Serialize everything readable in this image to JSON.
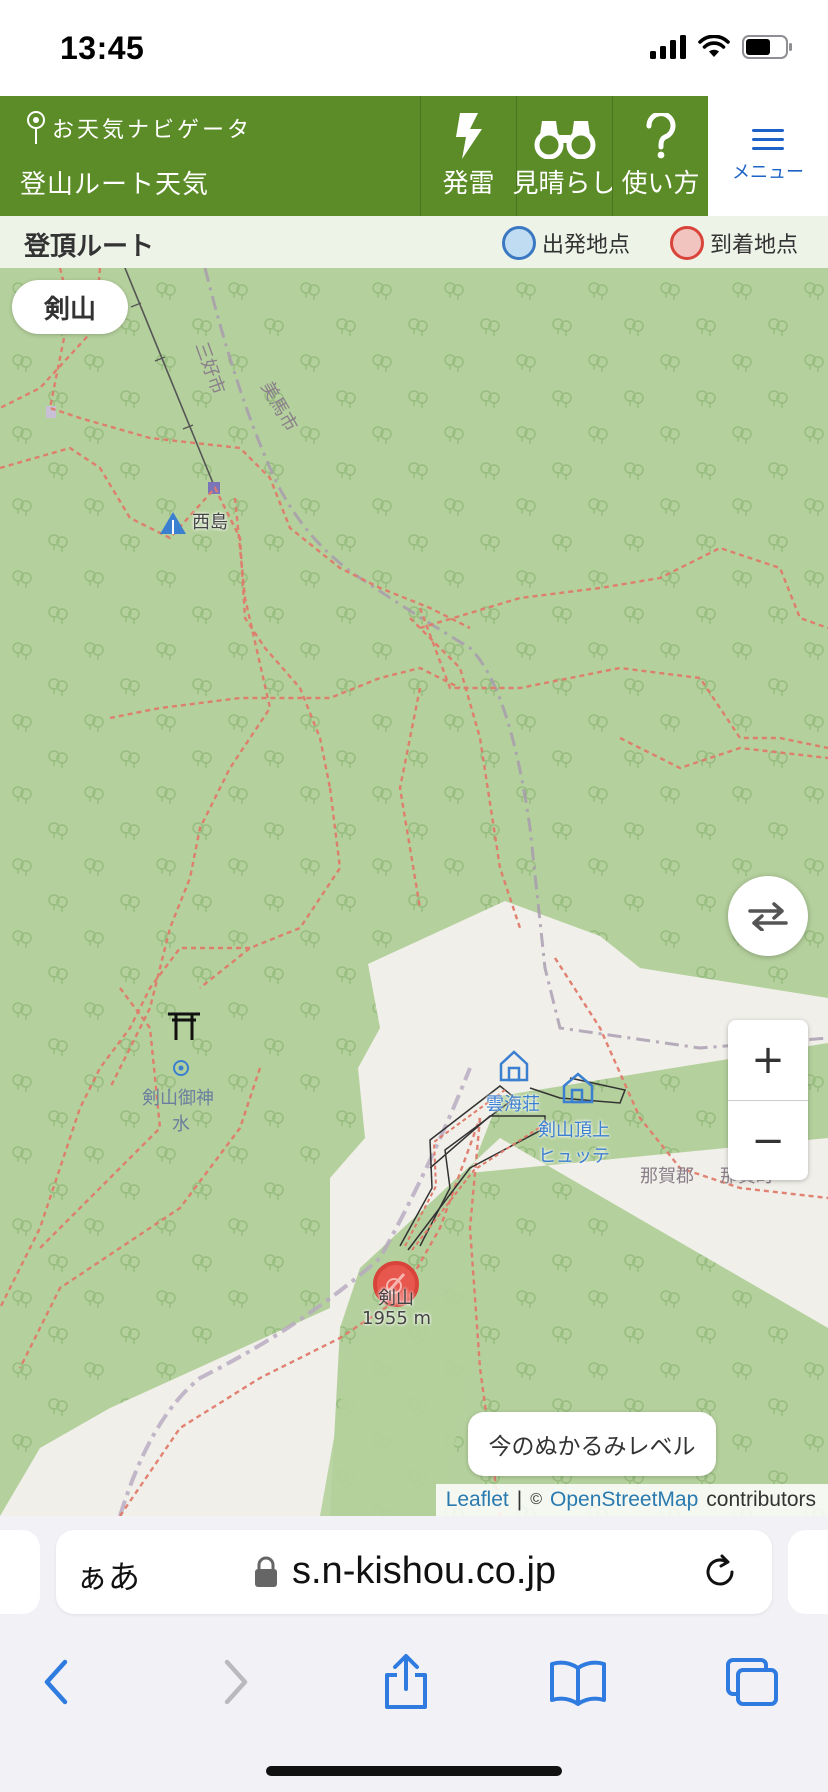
{
  "status_bar": {
    "time": "13:45"
  },
  "header": {
    "logo_text": "お天気ナビゲータ",
    "subtitle": "登山ルート天気",
    "buttons": [
      {
        "label": "発雷",
        "icon": "lightning-icon"
      },
      {
        "label": "見晴らし",
        "icon": "binoculars-icon"
      },
      {
        "label": "使い方",
        "icon": "question-icon"
      }
    ],
    "menu_label": "メニュー"
  },
  "route_bar": {
    "title": "登頂ルート",
    "legend": [
      {
        "label": "出発地点",
        "fill": "#bfdcf2",
        "stroke": "#3b78c2"
      },
      {
        "label": "到着地点",
        "fill": "#f2c4c0",
        "stroke": "#d9443a"
      }
    ]
  },
  "map": {
    "mountain_name": "剣山",
    "labels": {
      "city_miyoshi": "三好市",
      "city_mima": "美馬市",
      "nishijima": "西島",
      "shrine_water_1": "剣山御神",
      "shrine_water_2": "水",
      "unkaiso": "雲海荘",
      "hutte_1": "剣山頂上",
      "hutte_2": "ヒュッテ",
      "naka_gun_1": "那賀郡",
      "naka_gun_2": "那賀町",
      "peak_name": "剣山",
      "peak_elevation": "1955 m"
    },
    "mud_button": "今のぬかるみレベル",
    "zoom_in": "+",
    "zoom_out": "−",
    "attribution": {
      "leaflet": "Leaflet",
      "separator": "|",
      "copyright": "©",
      "osm": "OpenStreetMap",
      "contributors": "contributors"
    },
    "colors": {
      "forest": "#b4d09c",
      "summit_area": "#f0efe9",
      "trail": "#e07b6b",
      "boundary": "#a89aaf",
      "arrival_marker": "#d9443a"
    }
  },
  "browser": {
    "aa_label": "ぁあ",
    "url": "s.n-kishou.co.jp",
    "accent": "#2f7be0"
  }
}
